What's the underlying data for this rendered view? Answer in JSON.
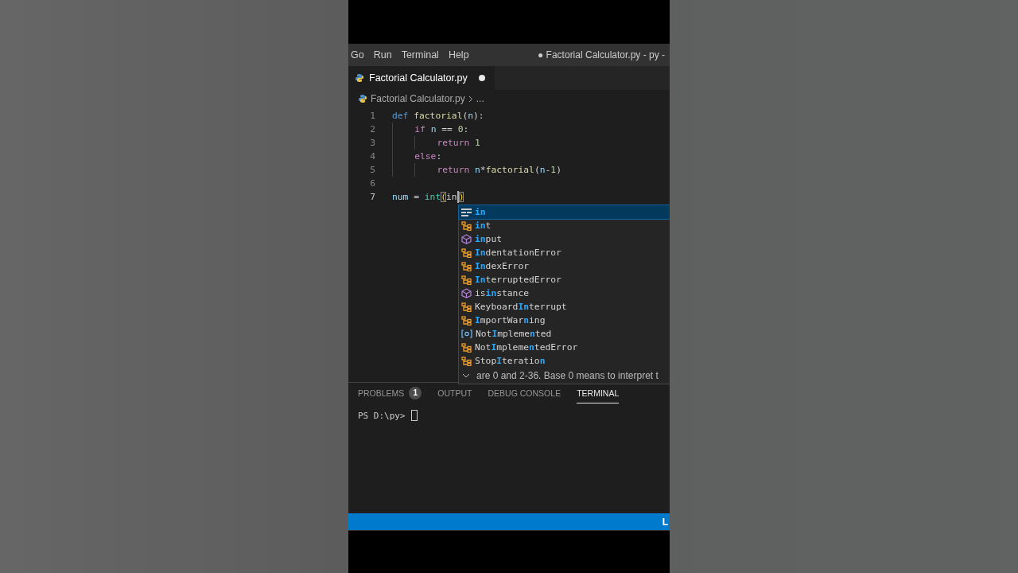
{
  "menu": [
    "Go",
    "Run",
    "Terminal",
    "Help"
  ],
  "window_title": "● Factorial Calculator.py - py -",
  "tabs": [
    {
      "label": "Factorial Calculator.py",
      "selected": true,
      "modified": true
    }
  ],
  "breadcrumb": [
    "Factorial Calculator.py",
    "..."
  ],
  "code_lines": [
    {
      "number": "1",
      "current": false,
      "tokens": [
        {
          "text": "def ",
          "kind": "keyword"
        },
        {
          "text": "factorial",
          "kind": "function"
        },
        {
          "text": "(",
          "kind": "plain"
        },
        {
          "text": "n",
          "kind": "param"
        },
        {
          "text": "):",
          "kind": "plain"
        }
      ]
    },
    {
      "number": "2",
      "current": false,
      "tokens": [
        {
          "text": "    if ",
          "kind": "control"
        },
        {
          "text": "n",
          "kind": "param"
        },
        {
          "text": " == ",
          "kind": "plain"
        },
        {
          "text": "0",
          "kind": "number"
        },
        {
          "text": ":",
          "kind": "plain"
        }
      ]
    },
    {
      "number": "3",
      "current": false,
      "tokens": [
        {
          "text": "        return ",
          "kind": "control"
        },
        {
          "text": "1",
          "kind": "number"
        }
      ]
    },
    {
      "number": "4",
      "current": false,
      "tokens": [
        {
          "text": "    else",
          "kind": "control"
        },
        {
          "text": ":",
          "kind": "plain"
        }
      ]
    },
    {
      "number": "5",
      "current": false,
      "tokens": [
        {
          "text": "        return ",
          "kind": "control"
        },
        {
          "text": "n",
          "kind": "param"
        },
        {
          "text": "*",
          "kind": "plain"
        },
        {
          "text": "factorial",
          "kind": "function"
        },
        {
          "text": "(",
          "kind": "plain"
        },
        {
          "text": "n",
          "kind": "param"
        },
        {
          "text": "-",
          "kind": "plain"
        },
        {
          "text": "1",
          "kind": "number"
        },
        {
          "text": ")",
          "kind": "plain"
        }
      ]
    },
    {
      "number": "6",
      "current": false
    },
    {
      "number": "7",
      "current": true,
      "tokens": [
        {
          "text": "num",
          "kind": "param"
        },
        {
          "text": " = ",
          "kind": "plain"
        },
        {
          "text": "int",
          "kind": "builtin"
        },
        {
          "text": "(",
          "kind": "bracket"
        },
        {
          "text": "in",
          "kind": "plain",
          "cursor_after": true
        },
        {
          "text": ")",
          "kind": "bracket"
        }
      ]
    }
  ],
  "suggestions": [
    {
      "kind": "keyword",
      "selected": true,
      "parts": [
        {
          "text": "in",
          "match": true
        }
      ]
    },
    {
      "kind": "class",
      "selected": false,
      "parts": [
        {
          "text": "in",
          "match": true
        },
        {
          "text": "t",
          "match": false
        }
      ]
    },
    {
      "kind": "function",
      "selected": false,
      "parts": [
        {
          "text": "in",
          "match": true
        },
        {
          "text": "put",
          "match": false
        }
      ]
    },
    {
      "kind": "class",
      "selected": false,
      "parts": [
        {
          "text": "In",
          "match": true
        },
        {
          "text": "dentationError",
          "match": false
        }
      ]
    },
    {
      "kind": "class",
      "selected": false,
      "parts": [
        {
          "text": "In",
          "match": true
        },
        {
          "text": "dexError",
          "match": false
        }
      ]
    },
    {
      "kind": "class",
      "selected": false,
      "parts": [
        {
          "text": "In",
          "match": true
        },
        {
          "text": "terruptedError",
          "match": false
        }
      ]
    },
    {
      "kind": "function",
      "selected": false,
      "parts": [
        {
          "text": "is",
          "match": false
        },
        {
          "text": "in",
          "match": true
        },
        {
          "text": "stance",
          "match": false
        }
      ]
    },
    {
      "kind": "class",
      "selected": false,
      "parts": [
        {
          "text": "Keyboard",
          "match": false
        },
        {
          "text": "In",
          "match": true
        },
        {
          "text": "terrupt",
          "match": false
        }
      ]
    },
    {
      "kind": "class",
      "selected": false,
      "parts": [
        {
          "text": "I",
          "match": true
        },
        {
          "text": "mportWar",
          "match": false
        },
        {
          "text": "n",
          "match": true
        },
        {
          "text": "ing",
          "match": false
        }
      ]
    },
    {
      "kind": "variable",
      "selected": false,
      "parts": [
        {
          "text": "Not",
          "match": false
        },
        {
          "text": "I",
          "match": true
        },
        {
          "text": "mpleme",
          "match": false
        },
        {
          "text": "n",
          "match": true
        },
        {
          "text": "ted",
          "match": false
        }
      ]
    },
    {
      "kind": "class",
      "selected": false,
      "parts": [
        {
          "text": "Not",
          "match": false
        },
        {
          "text": "I",
          "match": true
        },
        {
          "text": "mpleme",
          "match": false
        },
        {
          "text": "n",
          "match": true
        },
        {
          "text": "tedError",
          "match": false
        }
      ]
    },
    {
      "kind": "class",
      "selected": false,
      "parts": [
        {
          "text": "Stop",
          "match": false
        },
        {
          "text": "I",
          "match": true
        },
        {
          "text": "teratio",
          "match": false
        },
        {
          "text": "n",
          "match": true
        }
      ]
    }
  ],
  "doc_text": "are 0 and 2-36. Base 0 means to interpret t",
  "panel_tabs": [
    {
      "label": "PROBLEMS",
      "selected": false,
      "badge": "1"
    },
    {
      "label": "OUTPUT",
      "selected": false
    },
    {
      "label": "DEBUG CONSOLE",
      "selected": false
    },
    {
      "label": "TERMINAL",
      "selected": true
    }
  ],
  "terminal_prompt": "PS D:\\py>",
  "status_bar": {
    "text": "L"
  }
}
